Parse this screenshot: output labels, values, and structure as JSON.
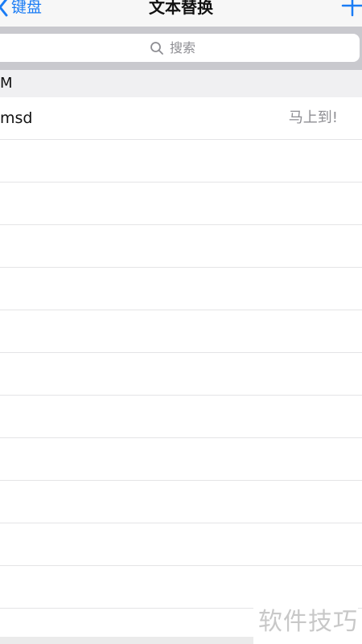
{
  "navbar": {
    "back_label": "键盘",
    "title": "文本替换",
    "add_icon": "plus-icon",
    "back_icon": "chevron-left-icon"
  },
  "search": {
    "placeholder": "搜索",
    "icon": "search-icon"
  },
  "section": {
    "letter": "M"
  },
  "rows": [
    {
      "phrase": "msd",
      "shortcut": "马上到!"
    },
    {
      "phrase": "",
      "shortcut": ""
    },
    {
      "phrase": "",
      "shortcut": ""
    },
    {
      "phrase": "",
      "shortcut": ""
    },
    {
      "phrase": "",
      "shortcut": ""
    },
    {
      "phrase": "",
      "shortcut": ""
    },
    {
      "phrase": "",
      "shortcut": ""
    },
    {
      "phrase": "",
      "shortcut": ""
    },
    {
      "phrase": "",
      "shortcut": ""
    },
    {
      "phrase": "",
      "shortcut": ""
    },
    {
      "phrase": "",
      "shortcut": ""
    },
    {
      "phrase": "",
      "shortcut": ""
    }
  ],
  "watermark": "软件技巧",
  "colors": {
    "accent": "#1a7cf5",
    "secondary_text": "#8e8e93",
    "search_bg": "#c9c9ce"
  }
}
